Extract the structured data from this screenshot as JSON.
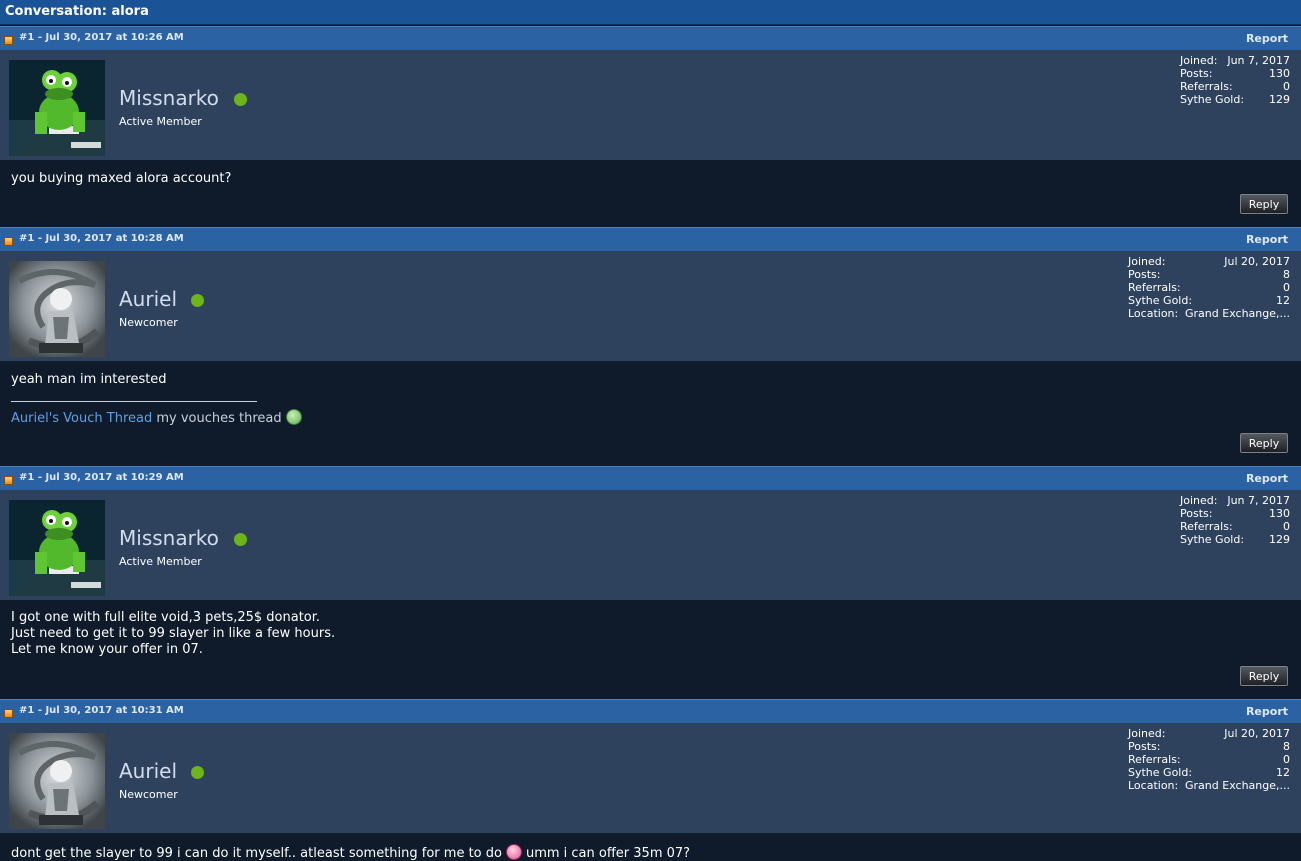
{
  "conversation": {
    "title": "Conversation: alora"
  },
  "posts": [
    {
      "header": "#1 - Jul 30, 2017 at 10:26 AM",
      "report_label": "Report",
      "user": {
        "name": "Missnarko",
        "title": "Active Member",
        "avatar": "kermit-avatar"
      },
      "stats": [
        {
          "label": "Joined:",
          "value": "Jun 7, 2017"
        },
        {
          "label": "Posts:",
          "value": "130"
        },
        {
          "label": "Referrals:",
          "value": "0"
        },
        {
          "label": "Sythe Gold:",
          "value": "129"
        }
      ],
      "message": [
        "you buying maxed alora account?"
      ],
      "reply_label": "Reply"
    },
    {
      "header": "#1 - Jul 30, 2017 at 10:28 AM",
      "report_label": "Report",
      "user": {
        "name": "Auriel",
        "title": "Newcomer",
        "avatar": "warrior-avatar"
      },
      "stats": [
        {
          "label": "Joined:",
          "value": "Jul 20, 2017"
        },
        {
          "label": "Posts:",
          "value": "8"
        },
        {
          "label": "Referrals:",
          "value": "0"
        },
        {
          "label": "Sythe Gold:",
          "value": "12"
        },
        {
          "label": "Location:",
          "value": "Grand Exchange,..."
        }
      ],
      "message": [
        "yeah man im interested"
      ],
      "signature": {
        "link": "Auriel's Vouch Thread",
        "text": "my vouches thread",
        "smiley": "grin-smiley"
      },
      "reply_label": "Reply"
    },
    {
      "header": "#1 - Jul 30, 2017 at 10:29 AM",
      "report_label": "Report",
      "user": {
        "name": "Missnarko",
        "title": "Active Member",
        "avatar": "kermit-avatar"
      },
      "stats": [
        {
          "label": "Joined:",
          "value": "Jun 7, 2017"
        },
        {
          "label": "Posts:",
          "value": "130"
        },
        {
          "label": "Referrals:",
          "value": "0"
        },
        {
          "label": "Sythe Gold:",
          "value": "129"
        }
      ],
      "message": [
        "I got one with full elite void,3 pets,25$ donator.",
        "Just need to get it to 99 slayer in like a few hours.",
        "Let me know your offer in 07."
      ],
      "reply_label": "Reply"
    },
    {
      "header": "#1 - Jul 30, 2017 at 10:31 AM",
      "report_label": "Report",
      "user": {
        "name": "Auriel",
        "title": "Newcomer",
        "avatar": "warrior-avatar"
      },
      "stats": [
        {
          "label": "Joined:",
          "value": "Jul 20, 2017"
        },
        {
          "label": "Posts:",
          "value": "8"
        },
        {
          "label": "Referrals:",
          "value": "0"
        },
        {
          "label": "Sythe Gold:",
          "value": "12"
        },
        {
          "label": "Location:",
          "value": "Grand Exchange,..."
        }
      ],
      "message": {
        "before": "dont get the slayer to 99 i can do it myself.. atleast something for me to do",
        "smiley": "tongue-smiley",
        "after": "umm i can offer 35m 07?"
      }
    }
  ],
  "colors": {
    "title_bar": "#1a5497",
    "post_header": "#2a62a3",
    "user_panel": "#2e425e",
    "body": "#0f1b2b",
    "online": "#6bb51a",
    "link": "#5f9fe6"
  }
}
